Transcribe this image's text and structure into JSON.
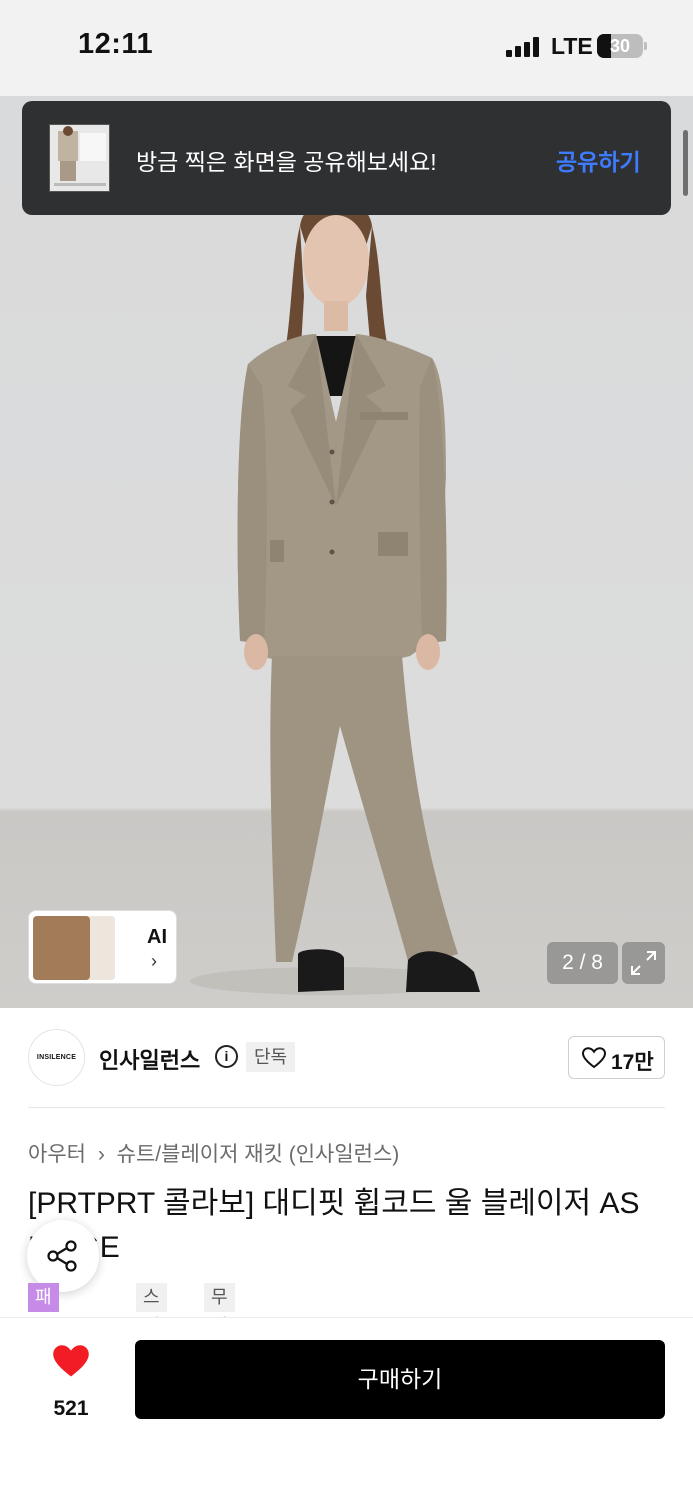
{
  "status_bar": {
    "time": "12:11",
    "network": "LTE",
    "battery_level": "30",
    "battery_percent": 30
  },
  "toast": {
    "message": "방금 찍은 화면을 공유해보세요!",
    "action_label": "공유하기"
  },
  "gallery": {
    "ai_label": "AI",
    "ai_chevron": "›",
    "counter": "2 / 8"
  },
  "brand": {
    "logo_text": "INSILENCE",
    "name": "인사일런스",
    "info_glyph": "i",
    "badge": "단독"
  },
  "likes_box": {
    "count": "17만"
  },
  "breadcrumb": {
    "category": "아우터",
    "separator": "›",
    "subcategory": "슈트/블레이저 재킷 (인사일런스)"
  },
  "product": {
    "title": "[PRTPRT 콜라보] 대디핏 휩코드 울 블레이저 AS BEIGE"
  },
  "tags": [
    {
      "label": "패션 페스타",
      "color": "#c58be6",
      "text_color": "#ffffff"
    },
    {
      "label": "스페셜",
      "color": "#f0f0f0",
      "text_color": "#555555"
    },
    {
      "label": "무신사단독",
      "color": "#f0f0f0",
      "text_color": "#555555"
    }
  ],
  "bottom_bar": {
    "wish_count": "521",
    "buy_label": "구매하기"
  },
  "colors": {
    "accent_blue": "#3d7bff",
    "heart_red": "#f21c25",
    "toast_bg": "#2f3032"
  },
  "icons": [
    "signal-icon",
    "battery-icon",
    "info-icon",
    "heart-outline-icon",
    "share-icon",
    "expand-icon",
    "heart-filled-icon",
    "chevron-right-icon"
  ]
}
